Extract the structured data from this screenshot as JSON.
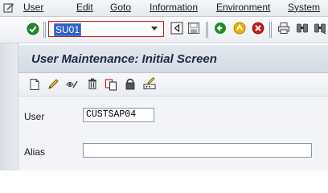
{
  "menubar": {
    "icon": "menu-icon",
    "items": [
      "User",
      "Edit",
      "Goto",
      "Information",
      "Environment",
      "System"
    ]
  },
  "toolbar": {
    "command_value": "SU01",
    "icons": [
      "enter-checkmark-icon",
      "save-icon",
      "back-icon",
      "exit-icon",
      "cancel-icon",
      "print-icon",
      "find-icon",
      "find-next-icon"
    ]
  },
  "title": "User Maintenance: Initial Screen",
  "app_toolbar": {
    "icons": [
      "create-icon",
      "change-icon",
      "display-icon",
      "delete-icon",
      "copy-icon",
      "lock-icon",
      "change-password-icon"
    ]
  },
  "form": {
    "user_label": "User",
    "user_value": "CUSTSAP04",
    "alias_label": "Alias",
    "alias_value": ""
  },
  "colors": {
    "command_highlight": "#2f5fc9",
    "required_frame": "#d11a1a",
    "title_text": "#1b2b44"
  }
}
